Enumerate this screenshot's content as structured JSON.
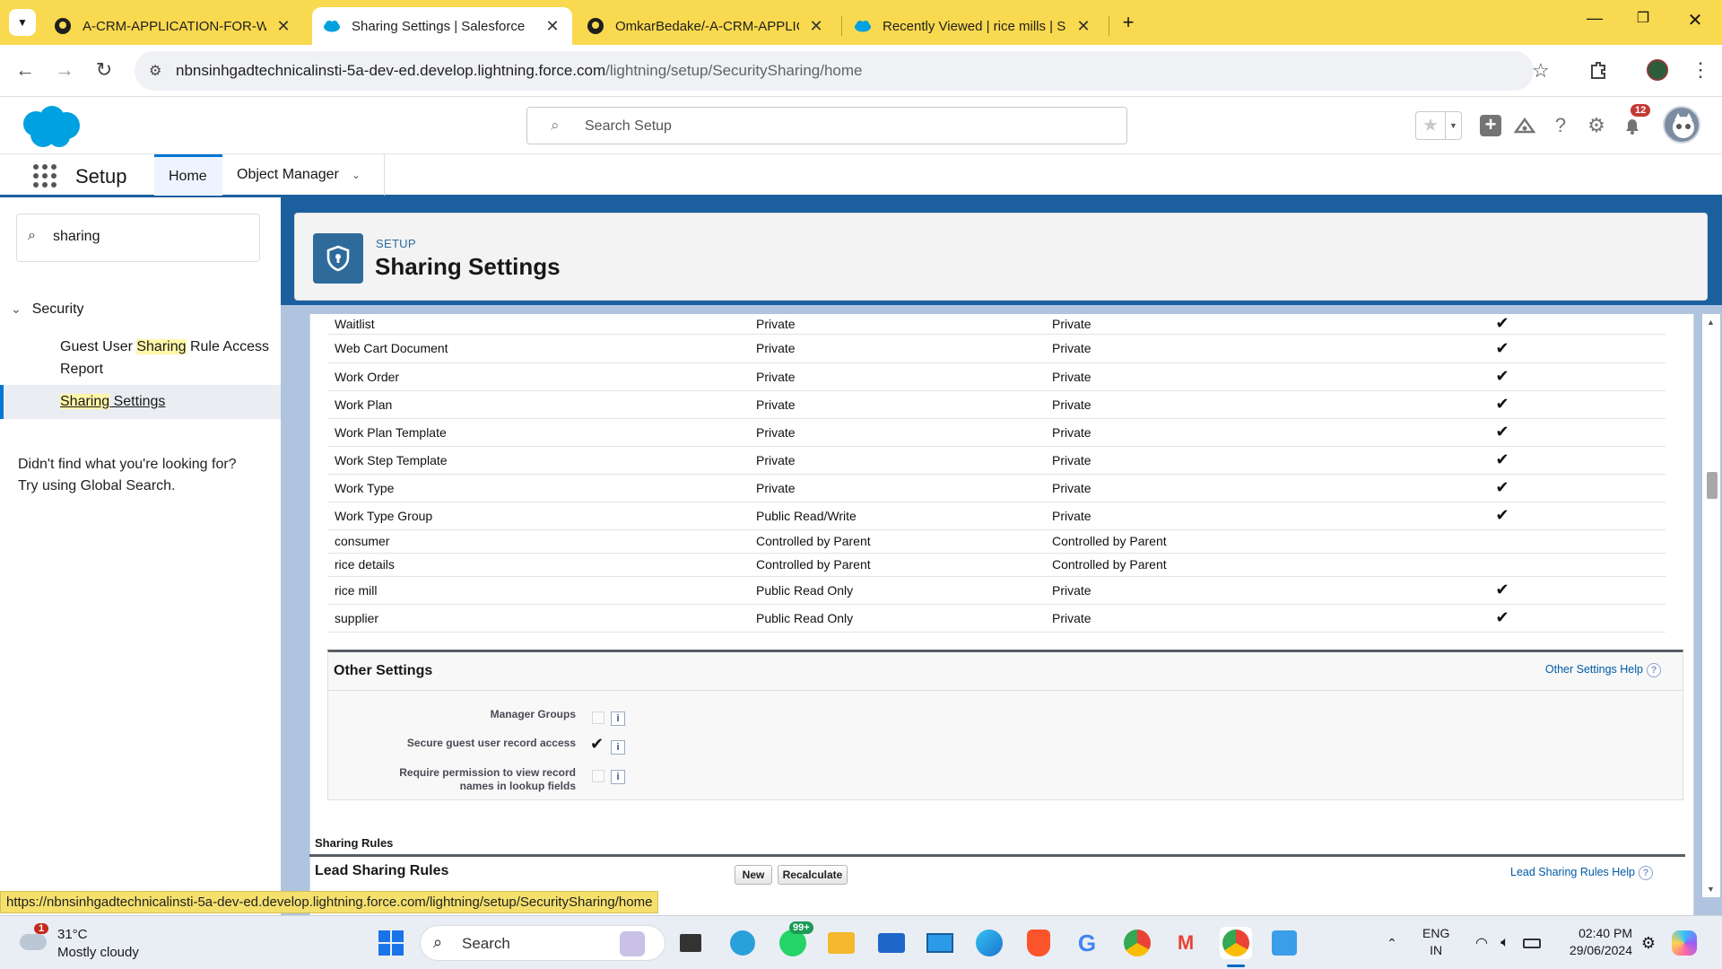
{
  "browser": {
    "tabs": [
      {
        "title": "A-CRM-APPLICATION-FOR-WH",
        "icon": "github-icon",
        "active": false
      },
      {
        "title": "Sharing Settings | Salesforce",
        "icon": "salesforce-cloud-icon",
        "active": true
      },
      {
        "title": "OmkarBedake/-A-CRM-APPLIC",
        "icon": "github-icon",
        "active": false
      },
      {
        "title": "Recently Viewed | rice mills | Sal",
        "icon": "salesforce-cloud-icon",
        "active": false
      }
    ],
    "url_host": "nbnsinhgadtechnicalinsti-5a-dev-ed.develop.lightning.force.com",
    "url_path": "/lightning/setup/SecuritySharing/home",
    "status_url": "https://nbnsinhgadtechnicalinsti-5a-dev-ed.develop.lightning.force.com/lightning/setup/SecuritySharing/home"
  },
  "header": {
    "search_placeholder": "Search Setup",
    "notification_count": "12"
  },
  "nav": {
    "app_title": "Setup",
    "tabs": [
      "Home",
      "Object Manager"
    ]
  },
  "sidebar": {
    "quickfind_value": "sharing",
    "section": "Security",
    "items": [
      {
        "pre": "Guest User ",
        "hl": "Sharing",
        "post": " Rule Access",
        "line2": "Report"
      },
      {
        "pre": "",
        "hl": "Sharing",
        "post": " Settings",
        "line2": ""
      }
    ],
    "not_found_1": "Didn't find what you're looking for?",
    "not_found_2": "Try using Global Search."
  },
  "page": {
    "breadcrumb": "SETUP",
    "title": "Sharing Settings"
  },
  "objects": [
    {
      "name": "Waitlist",
      "internal": "Private",
      "external": "Private",
      "check": true
    },
    {
      "name": "Web Cart Document",
      "internal": "Private",
      "external": "Private",
      "check": true
    },
    {
      "name": "Work Order",
      "internal": "Private",
      "external": "Private",
      "check": true
    },
    {
      "name": "Work Plan",
      "internal": "Private",
      "external": "Private",
      "check": true
    },
    {
      "name": "Work Plan Template",
      "internal": "Private",
      "external": "Private",
      "check": true
    },
    {
      "name": "Work Step Template",
      "internal": "Private",
      "external": "Private",
      "check": true
    },
    {
      "name": "Work Type",
      "internal": "Private",
      "external": "Private",
      "check": true
    },
    {
      "name": "Work Type Group",
      "internal": "Public Read/Write",
      "external": "Private",
      "check": true
    },
    {
      "name": "consumer",
      "internal": "Controlled by Parent",
      "external": "Controlled by Parent",
      "check": false
    },
    {
      "name": "rice details",
      "internal": "Controlled by Parent",
      "external": "Controlled by Parent",
      "check": false
    },
    {
      "name": "rice mill",
      "internal": "Public Read Only",
      "external": "Private",
      "check": true
    },
    {
      "name": "supplier",
      "internal": "Public Read Only",
      "external": "Private",
      "check": true
    }
  ],
  "other_settings": {
    "title": "Other Settings",
    "help": "Other Settings Help",
    "rows": [
      {
        "label1": "Manager Groups",
        "label2": "",
        "checked": false
      },
      {
        "label1": "Secure guest user record access",
        "label2": "",
        "checked": true
      },
      {
        "label1": "Require permission to view record",
        "label2": "names in lookup fields",
        "checked": false
      }
    ]
  },
  "sharing_rules": {
    "section_label": "Sharing Rules",
    "lead_title": "Lead Sharing Rules",
    "new_label": "New",
    "recalc_label": "Recalculate",
    "help": "Lead Sharing Rules Help"
  },
  "taskbar": {
    "weather_temp": "31°C",
    "weather_desc": "Mostly cloudy",
    "weather_badge": "1",
    "search_label": "Search",
    "whatsapp_badge": "99+",
    "lang1": "ENG",
    "lang2": "IN",
    "time": "02:40 PM",
    "date": "29/06/2024"
  },
  "colors": {
    "tabbar": "#f9d94f",
    "sf_blue": "#1b5f9e",
    "accent": "#0176d3"
  }
}
